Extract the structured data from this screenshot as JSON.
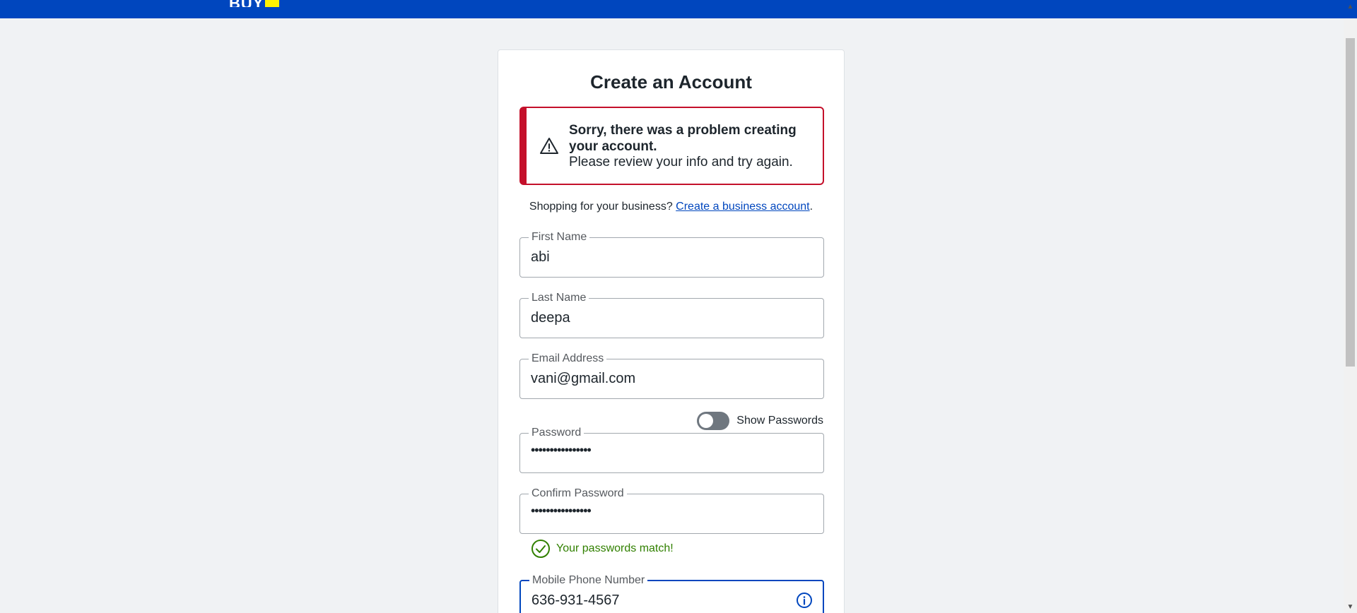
{
  "header": {
    "logo_text": "BUY"
  },
  "form": {
    "title": "Create an Account",
    "error": {
      "title": "Sorry, there was a problem creating your account.",
      "message": "Please review your info and try again."
    },
    "business_prompt": "Shopping for your business?",
    "business_link": "Create a business account",
    "business_suffix": ".",
    "fields": {
      "first_name": {
        "label": "First Name",
        "value": "abi"
      },
      "last_name": {
        "label": "Last Name",
        "value": "deepa"
      },
      "email": {
        "label": "Email Address",
        "value": "vani@gmail.com"
      },
      "password": {
        "label": "Password",
        "value": "••••••••••••••••"
      },
      "confirm_password": {
        "label": "Confirm Password",
        "value": "••••••••••••••••"
      },
      "mobile": {
        "label": "Mobile Phone Number",
        "value": "636-931-4567"
      }
    },
    "show_passwords_label": "Show Passwords",
    "show_passwords_on": false,
    "passwords_match": "Your passwords match!"
  },
  "colors": {
    "brand_blue": "#0046be",
    "brand_yellow": "#fff200",
    "error_red": "#c4102b",
    "success_green": "#318000"
  },
  "icons": {
    "error": "warning-triangle-icon",
    "match": "check-circle-icon",
    "info": "info-circle-icon"
  }
}
